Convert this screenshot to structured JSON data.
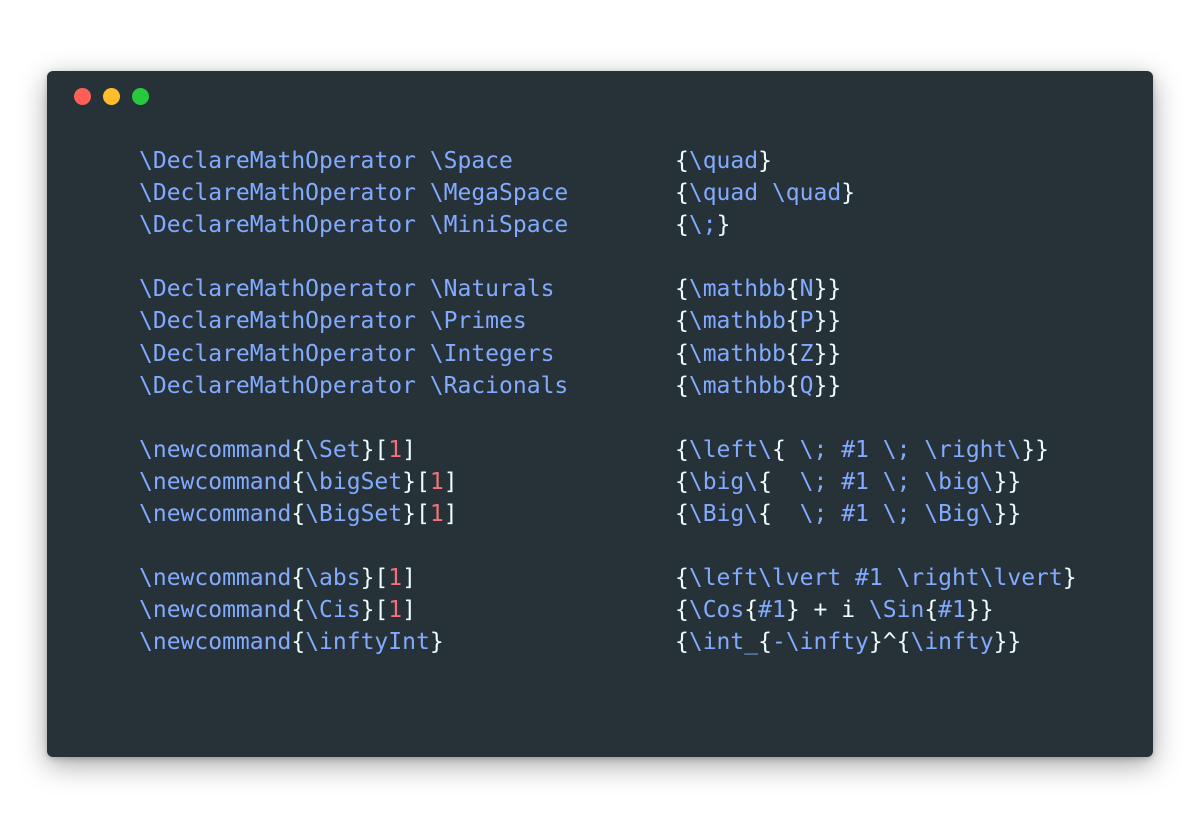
{
  "window": {
    "controls": [
      "close",
      "minimize",
      "maximize"
    ],
    "colors": {
      "background": "#263238",
      "close": "#ff5f56",
      "minimize": "#ffbd2e",
      "maximize": "#27c93f",
      "command": "#82aaff",
      "brace": "#eeffff",
      "number": "#f07178"
    }
  },
  "code": {
    "lines": [
      {
        "l": [
          [
            "cmd",
            "\\DeclareMathOperator \\Space"
          ]
        ],
        "r": [
          [
            "brace",
            "{"
          ],
          [
            "cmd",
            "\\quad"
          ],
          [
            "brace",
            "}"
          ]
        ]
      },
      {
        "l": [
          [
            "cmd",
            "\\DeclareMathOperator \\MegaSpace"
          ]
        ],
        "r": [
          [
            "brace",
            "{"
          ],
          [
            "cmd",
            "\\quad \\quad"
          ],
          [
            "brace",
            "}"
          ]
        ]
      },
      {
        "l": [
          [
            "cmd",
            "\\DeclareMathOperator \\MiniSpace"
          ]
        ],
        "r": [
          [
            "brace",
            "{"
          ],
          [
            "cmd",
            "\\;"
          ],
          [
            "brace",
            "}"
          ]
        ]
      },
      {
        "l": [],
        "r": []
      },
      {
        "l": [
          [
            "cmd",
            "\\DeclareMathOperator \\Naturals"
          ]
        ],
        "r": [
          [
            "brace",
            "{"
          ],
          [
            "cmd",
            "\\mathbb"
          ],
          [
            "brace",
            "{"
          ],
          [
            "cmd",
            "N"
          ],
          [
            "brace",
            "}}"
          ]
        ]
      },
      {
        "l": [
          [
            "cmd",
            "\\DeclareMathOperator \\Primes"
          ]
        ],
        "r": [
          [
            "brace",
            "{"
          ],
          [
            "cmd",
            "\\mathbb"
          ],
          [
            "brace",
            "{"
          ],
          [
            "cmd",
            "P"
          ],
          [
            "brace",
            "}}"
          ]
        ]
      },
      {
        "l": [
          [
            "cmd",
            "\\DeclareMathOperator \\Integers"
          ]
        ],
        "r": [
          [
            "brace",
            "{"
          ],
          [
            "cmd",
            "\\mathbb"
          ],
          [
            "brace",
            "{"
          ],
          [
            "cmd",
            "Z"
          ],
          [
            "brace",
            "}}"
          ]
        ]
      },
      {
        "l": [
          [
            "cmd",
            "\\DeclareMathOperator \\Racionals"
          ]
        ],
        "r": [
          [
            "brace",
            "{"
          ],
          [
            "cmd",
            "\\mathbb"
          ],
          [
            "brace",
            "{"
          ],
          [
            "cmd",
            "Q"
          ],
          [
            "brace",
            "}}"
          ]
        ]
      },
      {
        "l": [],
        "r": []
      },
      {
        "l": [
          [
            "cmd",
            "\\newcommand"
          ],
          [
            "brace",
            "{"
          ],
          [
            "cmd",
            "\\Set"
          ],
          [
            "brace",
            "}["
          ],
          [
            "num",
            "1"
          ],
          [
            "brace",
            "]"
          ]
        ],
        "r": [
          [
            "brace",
            "{"
          ],
          [
            "cmd",
            "\\left\\"
          ],
          [
            "brace",
            "{"
          ],
          [
            "cmd",
            " \\; #1 \\; \\right\\"
          ],
          [
            "brace",
            "}}"
          ]
        ]
      },
      {
        "l": [
          [
            "cmd",
            "\\newcommand"
          ],
          [
            "brace",
            "{"
          ],
          [
            "cmd",
            "\\bigSet"
          ],
          [
            "brace",
            "}["
          ],
          [
            "num",
            "1"
          ],
          [
            "brace",
            "]"
          ]
        ],
        "r": [
          [
            "brace",
            "{"
          ],
          [
            "cmd",
            "\\big\\"
          ],
          [
            "brace",
            "{"
          ],
          [
            "cmd",
            "  \\; #1 \\; \\big\\"
          ],
          [
            "brace",
            "}}"
          ]
        ]
      },
      {
        "l": [
          [
            "cmd",
            "\\newcommand"
          ],
          [
            "brace",
            "{"
          ],
          [
            "cmd",
            "\\BigSet"
          ],
          [
            "brace",
            "}["
          ],
          [
            "num",
            "1"
          ],
          [
            "brace",
            "]"
          ]
        ],
        "r": [
          [
            "brace",
            "{"
          ],
          [
            "cmd",
            "\\Big\\"
          ],
          [
            "brace",
            "{"
          ],
          [
            "cmd",
            "  \\; #1 \\; \\Big\\"
          ],
          [
            "brace",
            "}}"
          ]
        ]
      },
      {
        "l": [],
        "r": []
      },
      {
        "l": [
          [
            "cmd",
            "\\newcommand"
          ],
          [
            "brace",
            "{"
          ],
          [
            "cmd",
            "\\abs"
          ],
          [
            "brace",
            "}["
          ],
          [
            "num",
            "1"
          ],
          [
            "brace",
            "]"
          ]
        ],
        "r": [
          [
            "brace",
            "{"
          ],
          [
            "cmd",
            "\\left\\lvert #1 \\right\\lvert"
          ],
          [
            "brace",
            "}"
          ]
        ]
      },
      {
        "l": [
          [
            "cmd",
            "\\newcommand"
          ],
          [
            "brace",
            "{"
          ],
          [
            "cmd",
            "\\Cis"
          ],
          [
            "brace",
            "}["
          ],
          [
            "num",
            "1"
          ],
          [
            "brace",
            "]"
          ]
        ],
        "r": [
          [
            "brace",
            "{"
          ],
          [
            "cmd",
            "\\Cos"
          ],
          [
            "brace",
            "{"
          ],
          [
            "cmd",
            "#1"
          ],
          [
            "brace",
            "}"
          ],
          [
            "plain",
            " + i "
          ],
          [
            "cmd",
            "\\Sin"
          ],
          [
            "brace",
            "{"
          ],
          [
            "cmd",
            "#1"
          ],
          [
            "brace",
            "}}"
          ]
        ]
      },
      {
        "l": [
          [
            "cmd",
            "\\newcommand"
          ],
          [
            "brace",
            "{"
          ],
          [
            "cmd",
            "\\inftyInt"
          ],
          [
            "brace",
            "}"
          ]
        ],
        "r": [
          [
            "brace",
            "{"
          ],
          [
            "cmd",
            "\\int_"
          ],
          [
            "brace",
            "{"
          ],
          [
            "cmd",
            "-\\infty"
          ],
          [
            "brace",
            "}"
          ],
          [
            "plain",
            "^"
          ],
          [
            "brace",
            "{"
          ],
          [
            "cmd",
            "\\infty"
          ],
          [
            "brace",
            "}}"
          ]
        ]
      }
    ]
  }
}
